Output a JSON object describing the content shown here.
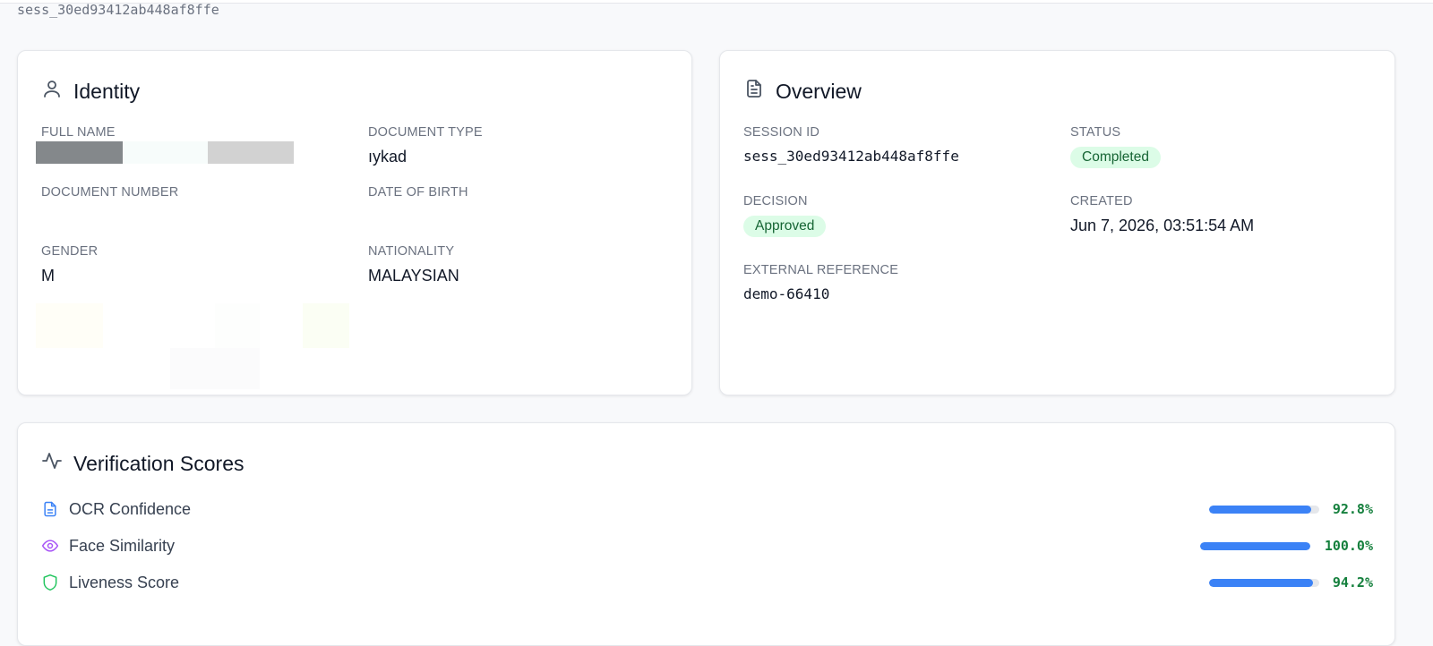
{
  "header": {
    "session_id": "sess_30ed93412ab448af8ffe"
  },
  "identity": {
    "title": "Identity",
    "full_name_label": "FULL NAME",
    "document_type_label": "DOCUMENT TYPE",
    "document_type_value": "ıykad",
    "document_number_label": "DOCUMENT NUMBER",
    "date_of_birth_label": "DATE OF BIRTH",
    "gender_label": "GENDER",
    "gender_value": "M",
    "nationality_label": "NATIONALITY",
    "nationality_value": "MALAYSIAN"
  },
  "overview": {
    "title": "Overview",
    "session_id_label": "SESSION ID",
    "session_id_value": "sess_30ed93412ab448af8ffe",
    "status_label": "STATUS",
    "status_value": "Completed",
    "decision_label": "DECISION",
    "decision_value": "Approved",
    "created_label": "CREATED",
    "created_value": "Jun 7, 2026, 03:51:54 AM",
    "external_reference_label": "EXTERNAL REFERENCE",
    "external_reference_value": "demo-66410"
  },
  "scores": {
    "title": "Verification Scores",
    "items": [
      {
        "label": "OCR Confidence",
        "value": 92.8,
        "display": "92.8%",
        "icon": "document-icon",
        "icon_color": "#3b82f6"
      },
      {
        "label": "Face Similarity",
        "value": 100.0,
        "display": "100.0%",
        "icon": "eye-icon",
        "icon_color": "#a855f7"
      },
      {
        "label": "Liveness Score",
        "value": 94.2,
        "display": "94.2%",
        "icon": "shield-icon",
        "icon_color": "#22c55e"
      }
    ]
  },
  "colors": {
    "badge_bg": "#dcfce7",
    "badge_text": "#166534",
    "bar_fill": "#3b82f6",
    "percent_text": "#15803d"
  }
}
